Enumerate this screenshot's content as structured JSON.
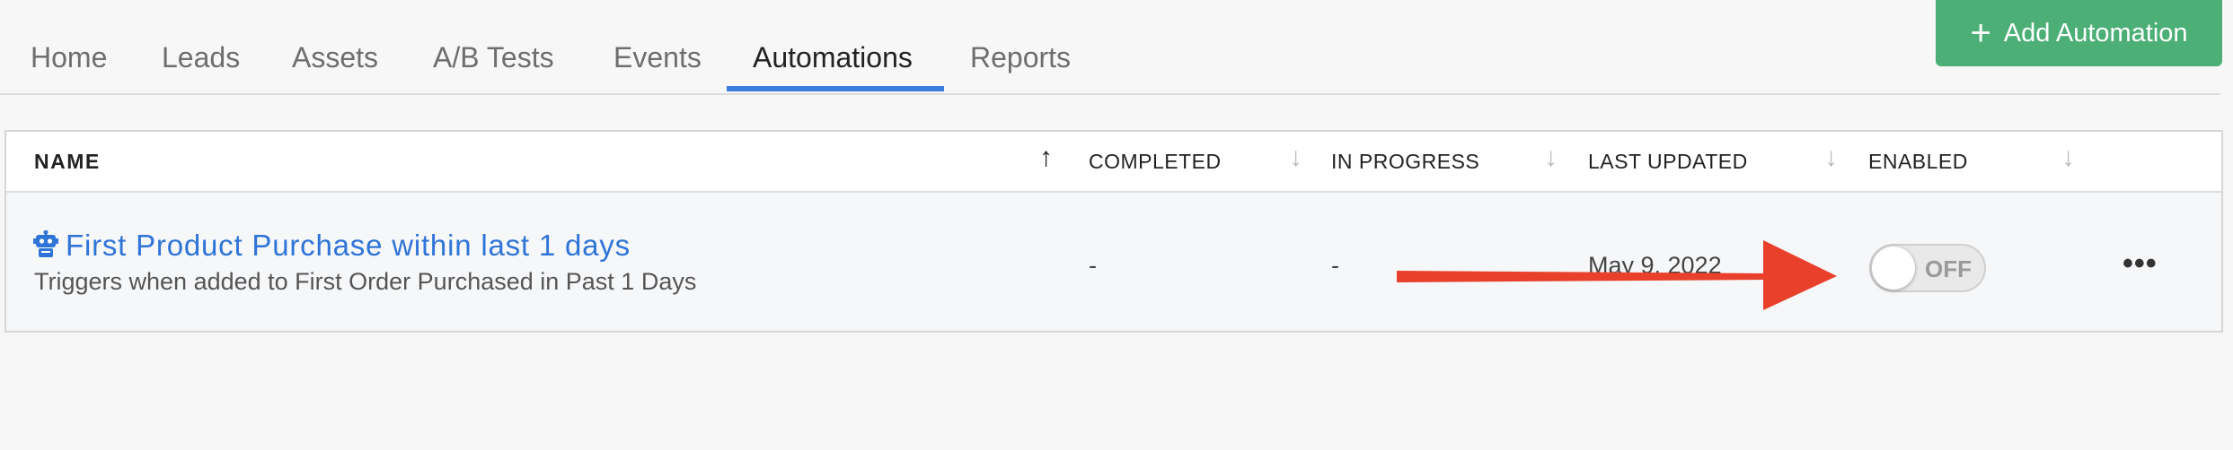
{
  "tabs": [
    {
      "label": "Home"
    },
    {
      "label": "Leads"
    },
    {
      "label": "Assets"
    },
    {
      "label": "A/B Tests"
    },
    {
      "label": "Events"
    },
    {
      "label": "Automations"
    },
    {
      "label": "Reports"
    }
  ],
  "active_tab": "Automations",
  "add_button": {
    "label": "Add Automation"
  },
  "table": {
    "headers": {
      "name": "NAME",
      "completed": "COMPLETED",
      "in_progress": "IN PROGRESS",
      "last_updated": "LAST UPDATED",
      "enabled": "ENABLED"
    },
    "sort_icons": {
      "name": "↑",
      "other": "↓"
    },
    "rows": [
      {
        "name": "First Product Purchase within last 1 days",
        "description": "Triggers when added to First Order Purchased in Past 1 Days",
        "completed": "-",
        "in_progress": "-",
        "last_updated": "May 9, 2022",
        "enabled_label": "OFF",
        "more": "•••"
      }
    ]
  },
  "colors": {
    "accent": "#3b7ddd",
    "link": "#2f74d8",
    "add_button_bg": "#4caf76",
    "annotation_arrow": "#e8402a"
  }
}
